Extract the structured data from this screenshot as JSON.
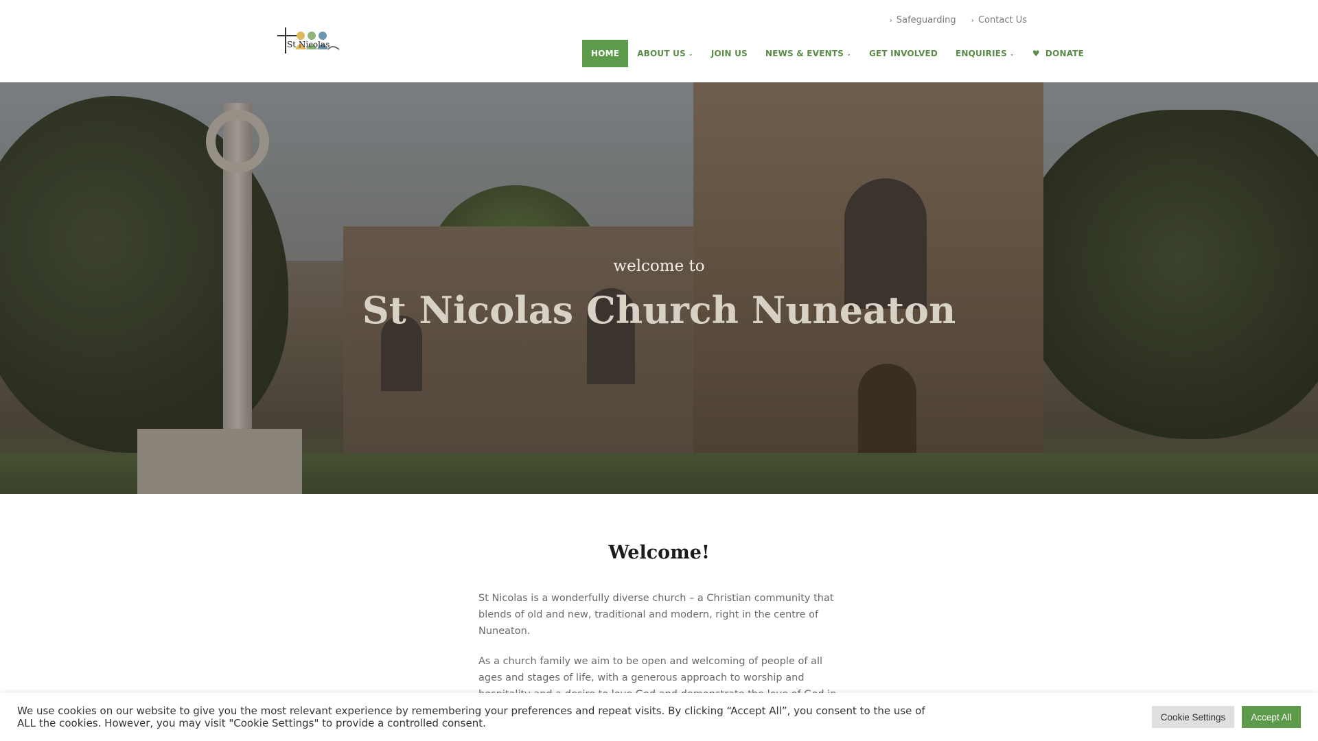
{
  "brand": {
    "logo_text": "St Nicolas",
    "accent_color": "#5d9a4a"
  },
  "topbar": {
    "links": [
      "Safeguarding",
      "Contact Us"
    ],
    "chevron_icon": "chevron-right-icon"
  },
  "nav": {
    "items": [
      {
        "label": "HOME",
        "active": true,
        "dropdown": false
      },
      {
        "label": "ABOUT US",
        "active": false,
        "dropdown": true
      },
      {
        "label": "JOIN US",
        "active": false,
        "dropdown": false
      },
      {
        "label": "NEWS & EVENTS",
        "active": false,
        "dropdown": true
      },
      {
        "label": "GET INVOLVED",
        "active": false,
        "dropdown": false
      },
      {
        "label": "ENQUIRIES",
        "active": false,
        "dropdown": true
      },
      {
        "label": "DONATE",
        "active": false,
        "dropdown": false,
        "icon": "heart-icon"
      }
    ]
  },
  "hero": {
    "subtitle": "welcome to",
    "title": "St Nicolas Church Nuneaton"
  },
  "main": {
    "heading": "Welcome!",
    "paragraphs": [
      "St Nicolas is a wonderfully diverse church – a Christian community that blends of old and new, traditional and modern, right in the centre of Nuneaton.",
      "As a church family we aim to be open and welcoming of people of all ages and stages of life, with a generous approach to worship and hospitality and a desire to love God and demonstrate the love of God in our local"
    ]
  },
  "cookie": {
    "text": "We use cookies on our website to give you the most relevant experience by remembering your preferences and repeat visits. By clicking “Accept All”, you consent to the use of ALL the cookies. However, you may visit \"Cookie Settings\" to provide a controlled consent.",
    "settings_label": "Cookie Settings",
    "accept_label": "Accept All"
  }
}
